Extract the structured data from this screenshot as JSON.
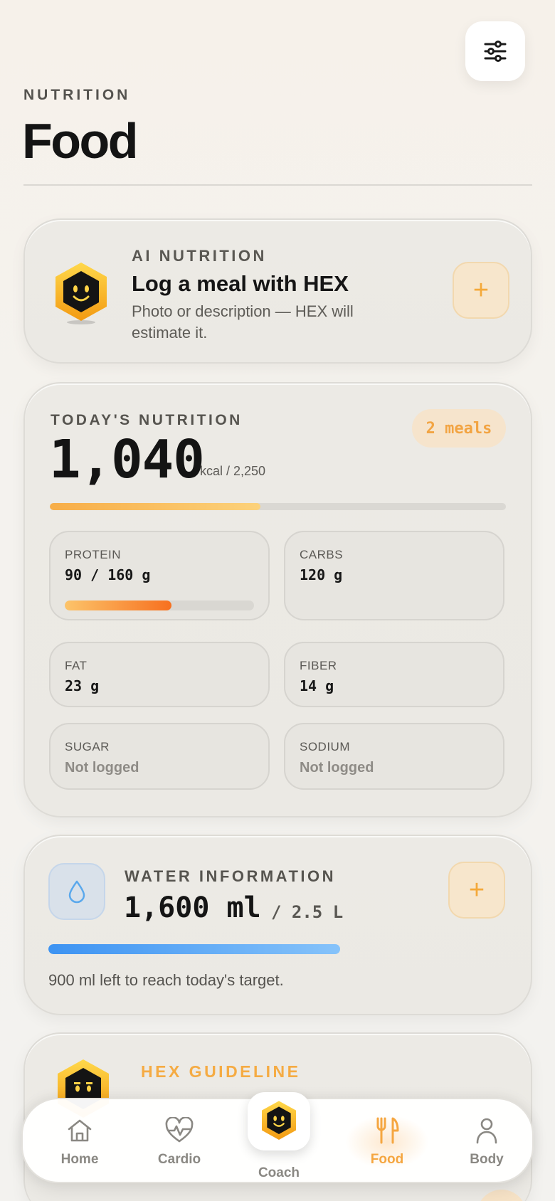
{
  "header": {
    "overline": "NUTRITION",
    "title": "Food",
    "filter_icon": "sliders-icon"
  },
  "ai_card": {
    "overline": "AI NUTRITION",
    "title": "Log a meal with HEX",
    "subtitle": "Photo or description — HEX will estimate it.",
    "add_label": "+"
  },
  "today": {
    "overline": "TODAY'S NUTRITION",
    "meals_badge": "2 meals",
    "kcal": "1,040",
    "kcal_goal": "kcal / 2,250",
    "kcal_progress": 0.462,
    "macros": {
      "protein": {
        "label": "PROTEIN",
        "value": "90 / 160 g",
        "progress": 0.5625
      },
      "carbs": {
        "label": "CARBS",
        "value": "120 g"
      },
      "fat": {
        "label": "FAT",
        "value": "23 g"
      },
      "fiber": {
        "label": "FIBER",
        "value": "14 g"
      },
      "sugar": {
        "label": "SUGAR",
        "value": "Not logged"
      },
      "sodium": {
        "label": "SODIUM",
        "value": "Not logged"
      }
    }
  },
  "water": {
    "overline": "WATER INFORMATION",
    "value": "1,600 ml",
    "goal": "/ 2.5 L",
    "progress": 0.64,
    "note": "900 ml left to reach today's target.",
    "add_label": "+"
  },
  "guideline": {
    "title": "HEX GUIDELINE"
  },
  "nav": {
    "items": [
      {
        "label": "Home",
        "icon": "home-icon"
      },
      {
        "label": "Cardio",
        "icon": "heart-pulse-icon"
      },
      {
        "label": "Coach",
        "icon": "hex-coach-icon"
      },
      {
        "label": "Food",
        "icon": "fork-knife-icon",
        "active": true
      },
      {
        "label": "Body",
        "icon": "person-icon"
      }
    ]
  },
  "colors": {
    "accent": "#f5a640",
    "water": "#3d93f2",
    "protein": "#f7701f"
  }
}
